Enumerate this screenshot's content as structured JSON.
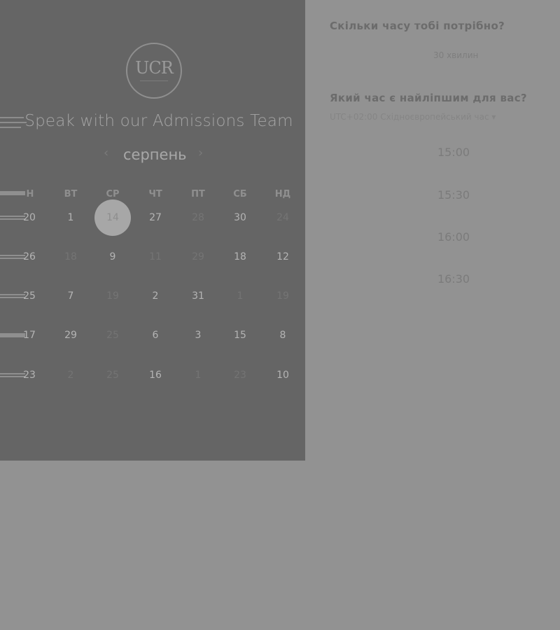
{
  "logo": {
    "text": "UCR"
  },
  "heading": "Speak with our Admissions Team",
  "calendar": {
    "month": "серпень",
    "prev_icon": "chevron-left-icon",
    "next_icon": "chevron-right-icon",
    "weekdays": [
      "Н",
      "ВТ",
      "СР",
      "ЧТ",
      "ПТ",
      "СБ",
      "НД"
    ],
    "rows": [
      [
        "20",
        "1",
        "14",
        "27",
        "28",
        "30",
        "24"
      ],
      [
        "26",
        "18",
        "9",
        "11",
        "29",
        "18",
        "12"
      ],
      [
        "25",
        "7",
        "19",
        "2",
        "31",
        "1",
        "19"
      ],
      [
        "17",
        "29",
        "25",
        "6",
        "3",
        "15",
        "8"
      ],
      [
        "23",
        "2",
        "25",
        "16",
        "1",
        "23",
        "10"
      ]
    ],
    "selected": "14"
  },
  "right": {
    "q_duration": "Скільки часу тобі потрібно?",
    "duration_value": "30 хвилин",
    "q_time": "Який час є найліпшим для вас?",
    "timezone": "UTC+02:00 Східноєвропейський час ▾",
    "slots": [
      "15:00",
      "15:30",
      "16:00",
      "16:30"
    ]
  }
}
